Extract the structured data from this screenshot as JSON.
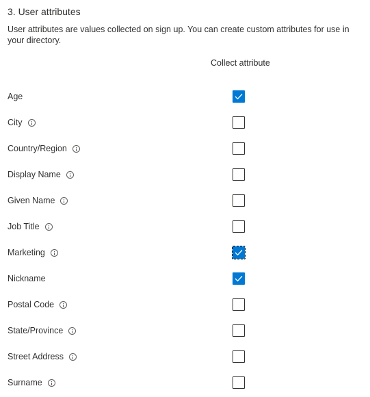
{
  "section": {
    "title": "3. User attributes",
    "description": "User attributes are values collected on sign up. You can create custom attributes for use in your directory."
  },
  "table": {
    "column_header": "Collect attribute",
    "rows": [
      {
        "label": "Age",
        "info": false,
        "checked": true,
        "focused": false
      },
      {
        "label": "City",
        "info": true,
        "checked": false,
        "focused": false
      },
      {
        "label": "Country/Region",
        "info": true,
        "checked": false,
        "focused": false
      },
      {
        "label": "Display Name",
        "info": true,
        "checked": false,
        "focused": false
      },
      {
        "label": "Given Name",
        "info": true,
        "checked": false,
        "focused": false
      },
      {
        "label": "Job Title",
        "info": true,
        "checked": false,
        "focused": false
      },
      {
        "label": "Marketing",
        "info": true,
        "checked": true,
        "focused": true
      },
      {
        "label": "Nickname",
        "info": false,
        "checked": true,
        "focused": false
      },
      {
        "label": "Postal Code",
        "info": true,
        "checked": false,
        "focused": false
      },
      {
        "label": "State/Province",
        "info": true,
        "checked": false,
        "focused": false
      },
      {
        "label": "Street Address",
        "info": true,
        "checked": false,
        "focused": false
      },
      {
        "label": "Surname",
        "info": true,
        "checked": false,
        "focused": false
      }
    ]
  },
  "colors": {
    "accent": "#0078d4",
    "text": "#323130",
    "border": "#323130"
  }
}
